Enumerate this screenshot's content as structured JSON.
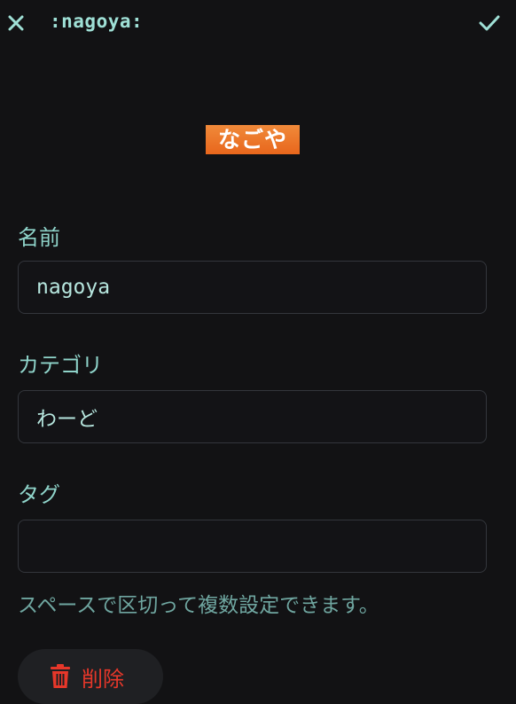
{
  "header": {
    "close_icon": "close-icon",
    "title": ":nagoya:",
    "confirm_icon": "check-icon"
  },
  "preview": {
    "text": "なごや",
    "bg_color": "#ea6f24",
    "text_color": "#ffffff"
  },
  "form": {
    "name_label": "名前",
    "name_value": "nagoya",
    "category_label": "カテゴリ",
    "category_value": "わーど",
    "tags_label": "タグ",
    "tags_value": "",
    "tags_hint": "スペースで区切って複数設定できます。"
  },
  "actions": {
    "delete_icon": "trash-icon",
    "delete_label": "削除"
  },
  "colors": {
    "background": "#121214",
    "accent": "#8fd4ca",
    "danger": "#e6372a"
  }
}
